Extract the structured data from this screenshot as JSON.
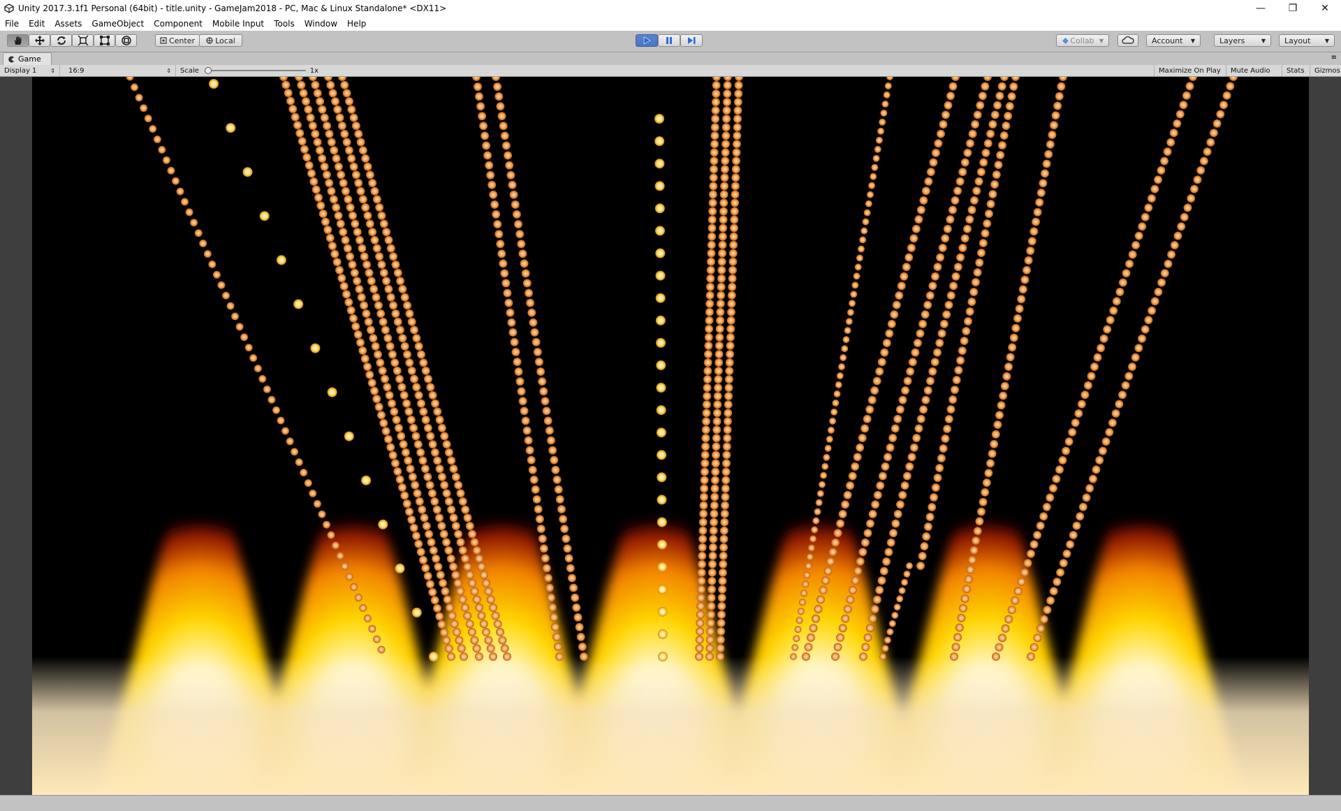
{
  "titlebar": {
    "title": "Unity 2017.3.1f1 Personal (64bit) - title.unity - GameJam2018 - PC, Mac & Linux Standalone* <DX11>",
    "minimize": "—",
    "maximize": "❐",
    "close": "✕"
  },
  "menu": [
    "File",
    "Edit",
    "Assets",
    "GameObject",
    "Component",
    "Mobile Input",
    "Tools",
    "Window",
    "Help"
  ],
  "toolbar": {
    "center_label": "Center",
    "local_label": "Local",
    "collab_label": "Collab",
    "account_label": "Account",
    "layers_label": "Layers",
    "layout_label": "Layout",
    "active_tool": "hand",
    "play_state": "playing",
    "play_color": "#4a75bf"
  },
  "game_view": {
    "tab_label": "Game",
    "display": "Display 1",
    "aspect": "16:9",
    "scale_label": "Scale",
    "scale_value": "1x",
    "maximize_on_play": "Maximize On Play",
    "mute_audio": "Mute Audio",
    "stats": "Stats",
    "gizmos": "Gizmos"
  },
  "colors": {
    "background": "#000000",
    "flame_core": "#ffffff",
    "flame_mid": "#ffd800",
    "flame_outer": "#ff6a00",
    "particle_orange": "#f0a050",
    "particle_yellow": "#ffe06a"
  }
}
